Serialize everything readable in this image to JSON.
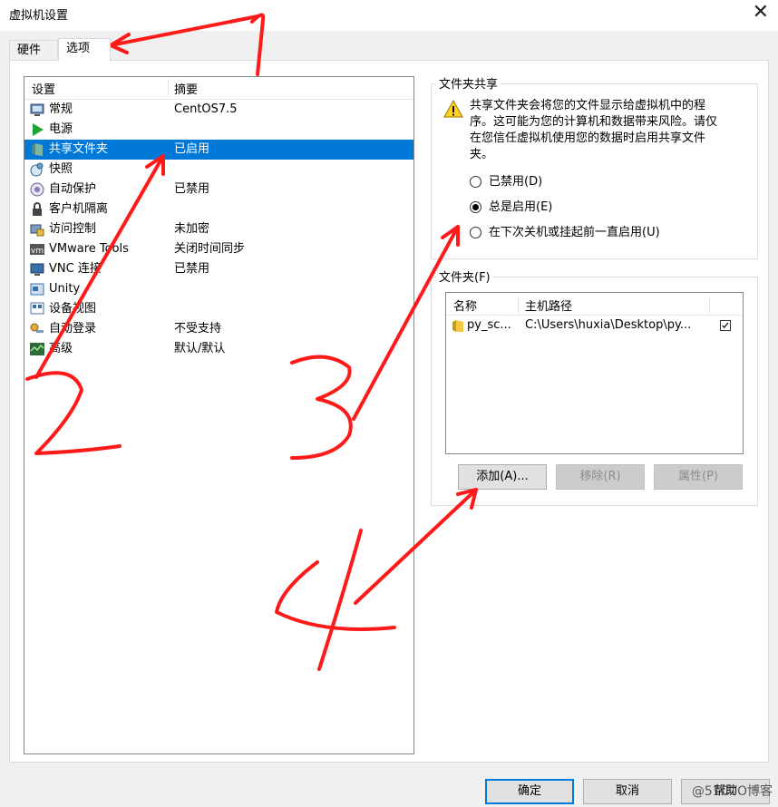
{
  "window": {
    "title": "虚拟机设置",
    "close_glyph": "✕"
  },
  "tabs": [
    {
      "label": "硬件",
      "active": false
    },
    {
      "label": "选项",
      "active": true
    }
  ],
  "settings_list": {
    "columns": [
      "设置",
      "摘要"
    ],
    "rows": [
      {
        "name": "常规",
        "summary": "CentOS7.5",
        "icon": "monitor-icon"
      },
      {
        "name": "电源",
        "summary": "",
        "icon": "play-icon"
      },
      {
        "name": "共享文件夹",
        "summary": "已启用",
        "icon": "shared-folder-icon",
        "selected": true
      },
      {
        "name": "快照",
        "summary": "",
        "icon": "snapshot-icon"
      },
      {
        "name": "自动保护",
        "summary": "已禁用",
        "icon": "autoprotect-icon"
      },
      {
        "name": "客户机隔离",
        "summary": "",
        "icon": "lock-icon"
      },
      {
        "name": "访问控制",
        "summary": "未加密",
        "icon": "access-control-icon"
      },
      {
        "name": "VMware Tools",
        "summary": "关闭时间同步",
        "icon": "vmware-tools-icon"
      },
      {
        "name": "VNC 连接",
        "summary": "已禁用",
        "icon": "vnc-icon"
      },
      {
        "name": "Unity",
        "summary": "",
        "icon": "unity-icon"
      },
      {
        "name": "设备视图",
        "summary": "",
        "icon": "device-view-icon"
      },
      {
        "name": "自动登录",
        "summary": "不受支持",
        "icon": "key-icon"
      },
      {
        "name": "高级",
        "summary": "默认/默认",
        "icon": "advanced-icon"
      }
    ]
  },
  "sharing": {
    "group_title": "文件夹共享",
    "warning": "共享文件夹会将您的文件显示给虚拟机中的程序。这可能为您的计算机和数据带来风险。请仅在您信任虚拟机使用您的数据时启用共享文件夹。",
    "options": [
      {
        "label": "已禁用(D)",
        "checked": false
      },
      {
        "label": "总是启用(E)",
        "checked": true
      },
      {
        "label": "在下次关机或挂起前一直启用(U)",
        "checked": false
      }
    ]
  },
  "folders": {
    "group_title": "文件夹(F)",
    "columns": [
      "名称",
      "主机路径"
    ],
    "rows": [
      {
        "name": "py_sc...",
        "path": "C:\\Users\\huxia\\Desktop\\py...",
        "enabled": true
      }
    ],
    "buttons": {
      "add": "添加(A)...",
      "remove": "移除(R)",
      "properties": "属性(P)"
    }
  },
  "footer": {
    "ok": "确定",
    "cancel": "取消",
    "help": "帮助"
  },
  "watermark": "@51CTO博客",
  "annotations": [
    "1",
    "2",
    "3",
    "4"
  ],
  "colors": {
    "selection": "#0078d7",
    "annotation": "#ff1a1a"
  }
}
